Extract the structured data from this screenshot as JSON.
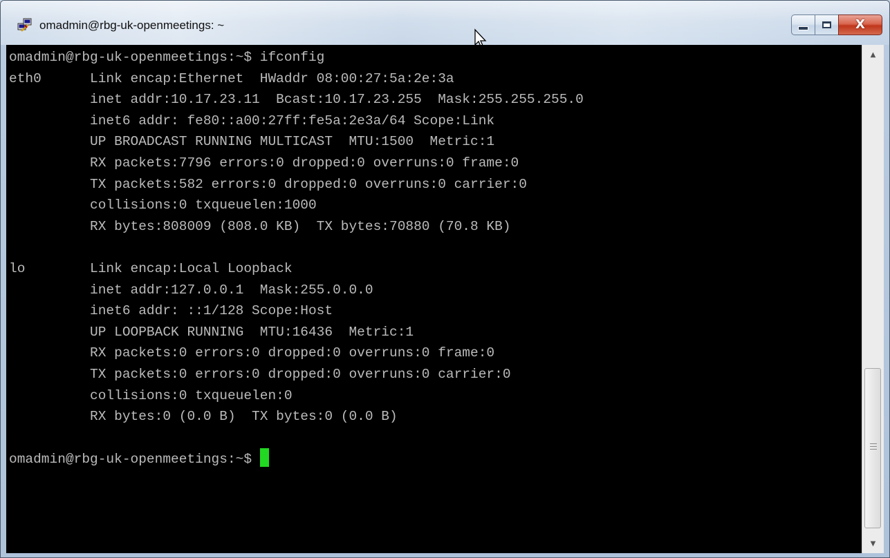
{
  "window": {
    "title": "omadmin@rbg-uk-openmeetings: ~",
    "icon": "putty-icon",
    "controls": {
      "minimize_icon": "minimize-icon",
      "maximize_icon": "maximize-icon",
      "close_icon": "close-icon",
      "close_glyph": "X"
    }
  },
  "terminal": {
    "lines": [
      "omadmin@rbg-uk-openmeetings:~$ ifconfig",
      "eth0      Link encap:Ethernet  HWaddr 08:00:27:5a:2e:3a",
      "          inet addr:10.17.23.11  Bcast:10.17.23.255  Mask:255.255.255.0",
      "          inet6 addr: fe80::a00:27ff:fe5a:2e3a/64 Scope:Link",
      "          UP BROADCAST RUNNING MULTICAST  MTU:1500  Metric:1",
      "          RX packets:7796 errors:0 dropped:0 overruns:0 frame:0",
      "          TX packets:582 errors:0 dropped:0 overruns:0 carrier:0",
      "          collisions:0 txqueuelen:1000",
      "          RX bytes:808009 (808.0 KB)  TX bytes:70880 (70.8 KB)",
      "",
      "lo        Link encap:Local Loopback",
      "          inet addr:127.0.0.1  Mask:255.0.0.0",
      "          inet6 addr: ::1/128 Scope:Host",
      "          UP LOOPBACK RUNNING  MTU:16436  Metric:1",
      "          RX packets:0 errors:0 dropped:0 overruns:0 frame:0",
      "          TX packets:0 errors:0 dropped:0 overruns:0 carrier:0",
      "          collisions:0 txqueuelen:0",
      "          RX bytes:0 (0.0 B)  TX bytes:0 (0.0 B)",
      ""
    ],
    "prompt": "omadmin@rbg-uk-openmeetings:~$ ",
    "cursor_color": "#22d822",
    "text_color": "#bbbbbb",
    "background_color": "#000000"
  },
  "scrollbar": {
    "up_arrow_icon": "scroll-up-arrow-icon",
    "down_arrow_icon": "scroll-down-arrow-icon",
    "up_glyph": "▲",
    "down_glyph": "▼"
  }
}
